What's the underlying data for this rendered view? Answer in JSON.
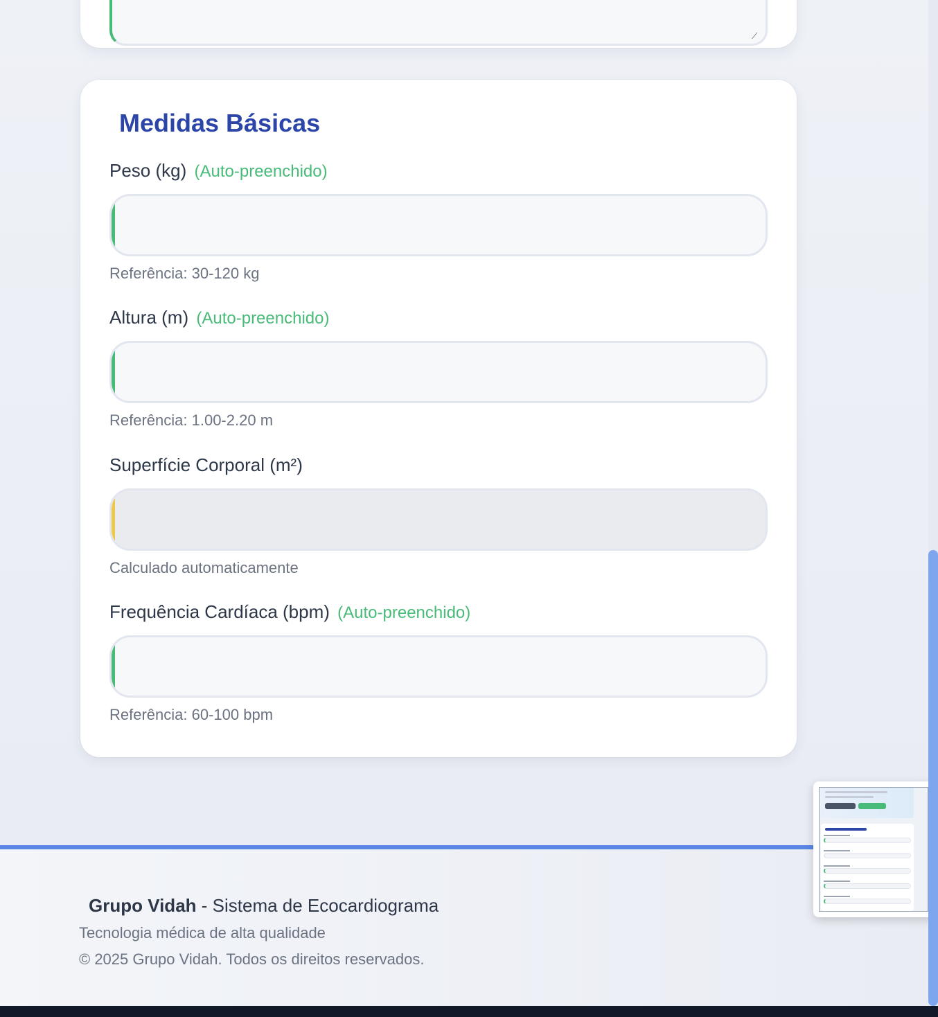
{
  "section": {
    "title": "Medidas Básicas",
    "auto_tag": "(Auto-preenchido)"
  },
  "fields": {
    "peso": {
      "label": "Peso (kg)",
      "auto": "(Auto-preenchido)",
      "value": "",
      "hint": "Referência: 30-120 kg"
    },
    "altura": {
      "label": "Altura (m)",
      "auto": "(Auto-preenchido)",
      "value": "",
      "hint": "Referência: 1.00-2.20 m"
    },
    "superficie": {
      "label": "Superfície Corporal (m²)",
      "value": "",
      "hint": "Calculado automaticamente"
    },
    "fc": {
      "label": "Frequência Cardíaca (bpm)",
      "auto": "(Auto-preenchido)",
      "value": "",
      "hint": "Referência: 60-100 bpm"
    }
  },
  "footer": {
    "brand": "Grupo Vidah",
    "brand_suffix": " - Sistema de Ecocardiograma",
    "subtitle": "Tecnologia médica de alta qualidade",
    "copyright": "© 2025 Grupo Vidah. Todos os direitos reservados."
  },
  "colors": {
    "accent_auto": "#48bb78",
    "accent_calc": "#ecc94b",
    "title": "#2b45a8",
    "footer_border": "#5a86e6"
  }
}
